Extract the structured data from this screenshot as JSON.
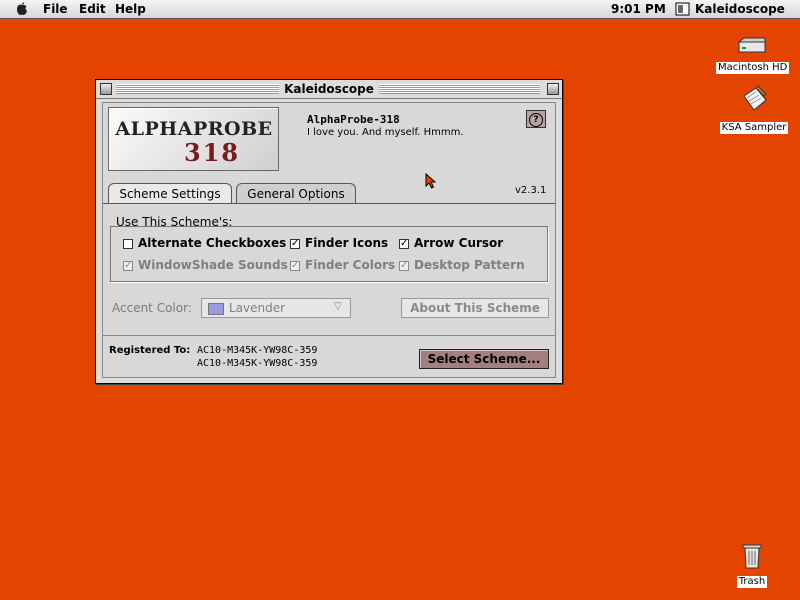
{
  "menubar": {
    "items": [
      "File",
      "Edit",
      "Help"
    ],
    "clock": "9:01 PM",
    "active_app": "Kaleidoscope"
  },
  "desktop": {
    "icons": [
      "Macintosh HD",
      "KSA Sampler",
      "Trash"
    ],
    "background_color": "#e34400"
  },
  "window": {
    "title": "Kaleidoscope",
    "logo": {
      "name": "ALPHAPROBE",
      "number": "318"
    },
    "scheme_name": "AlphaProbe-318",
    "scheme_description": "I love you. And myself. Hmmm.",
    "help_label": "?",
    "version": "v2.3.1",
    "tabs": [
      "Scheme Settings",
      "General Options"
    ],
    "group_label": "Use This Scheme's:",
    "options": [
      {
        "label": "Alternate Checkboxes",
        "checked": false,
        "enabled": true
      },
      {
        "label": "Finder Icons",
        "checked": true,
        "enabled": true
      },
      {
        "label": "Arrow Cursor",
        "checked": true,
        "enabled": true
      },
      {
        "label": "WindowShade Sounds",
        "checked": true,
        "enabled": false
      },
      {
        "label": "Finder Colors",
        "checked": true,
        "enabled": false
      },
      {
        "label": "Desktop Pattern",
        "checked": true,
        "enabled": false
      }
    ],
    "accent_label": "Accent Color:",
    "accent_value": "Lavender",
    "about_button": "About This Scheme",
    "registered_label": "Registered To:",
    "registration_codes": [
      "AC10-M345K-YW98C-359",
      "AC10-M345K-YW98C-359"
    ],
    "select_button": "Select Scheme..."
  }
}
